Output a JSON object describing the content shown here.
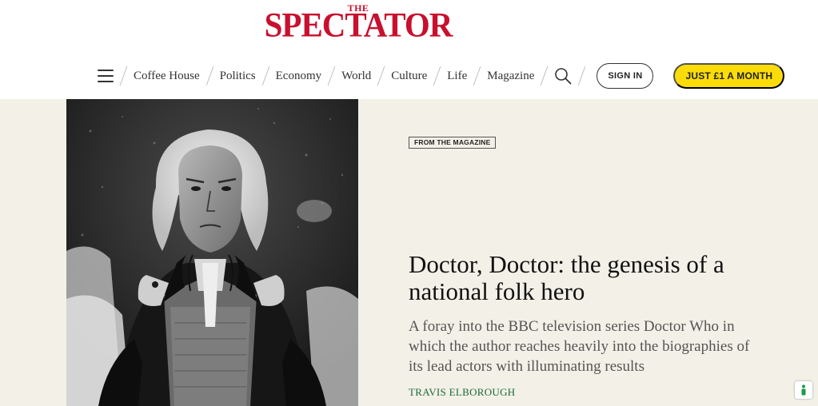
{
  "site": {
    "logo_small": "THE",
    "logo_main": "SPECTATOR",
    "brand_color": "#c8102e"
  },
  "nav": {
    "menu_icon": "hamburger-icon",
    "links": [
      "Coffee House",
      "Politics",
      "Economy",
      "World",
      "Culture",
      "Life",
      "Magazine"
    ],
    "search_icon": "search-icon",
    "sign_in": "SIGN IN",
    "subscribe": "JUST £1 A MONTH",
    "subscribe_color": "#fcdc08"
  },
  "article": {
    "image": "Black-and-white photo of an elderly actor with long white hair in Victorian costume, gripping his coat lapels",
    "tag": "FROM THE MAGAZINE",
    "headline": "Doctor, Doctor: the genesis of a national folk hero",
    "standfirst": "A foray into the BBC television series Doctor Who in which the author reaches heavily into the biographies of its lead actors with illuminating results",
    "author": "TRAVIS ELBOROUGH",
    "background": "#f3f0e7",
    "author_color": "#1a6b3a"
  },
  "accessibility": {
    "icon": "accessibility-icon"
  }
}
